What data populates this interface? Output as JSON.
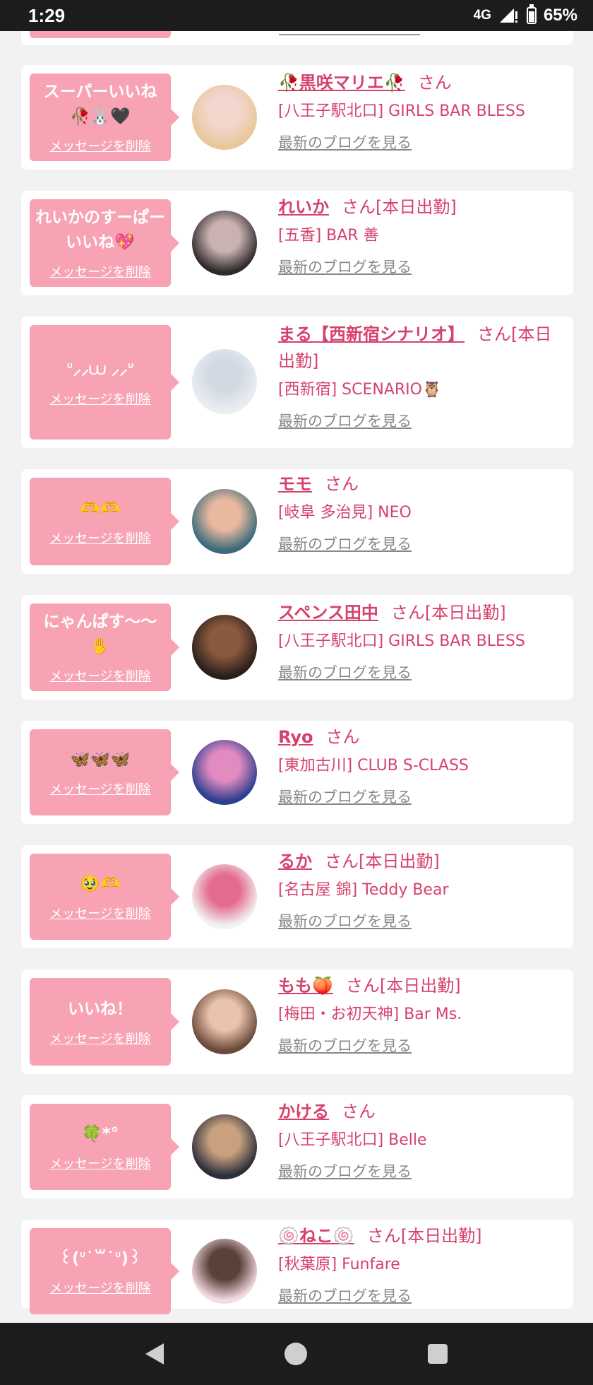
{
  "status": {
    "time": "1:29",
    "network": "4G",
    "battery": "65%"
  },
  "colors": {
    "accent": "#d6416b",
    "bubble": "#f7a3b4",
    "background": "#f2f2f2"
  },
  "common": {
    "delete_label": "メッセージを削除",
    "blog_label": "最新のブログを見る",
    "san_label": "さん"
  },
  "items": [
    {
      "message": "スーパーいいね🥀🐰🖤",
      "name": "🥀黒咲マリエ🥀",
      "suffix": "さん",
      "shop": "[八王子駅北口] GIRLS BAR BLESS",
      "avatar_colors": [
        "#e8c79a",
        "#f3d7cf"
      ]
    },
    {
      "message": "れいかのすーぱーいいね💖",
      "name": "れいか",
      "suffix": "さん[本日出勤]",
      "shop": "[五香] BAR 善",
      "avatar_colors": [
        "#2f2a2c",
        "#c9b2b0"
      ]
    },
    {
      "message": "ᐡ⸝⸝⩊ ⸝⸝ᐡ",
      "name": "まる【西新宿シナリオ】",
      "suffix": "さん[本日出勤]",
      "shop": "[西新宿] SCENARIO🦉",
      "avatar_colors": [
        "#e9eef3",
        "#d3d9e2"
      ]
    },
    {
      "message": "🫶🫶",
      "name": "モモ",
      "suffix": "さん",
      "shop": "[岐阜 多治見] NEO",
      "avatar_colors": [
        "#3b6a7a",
        "#e8b89f"
      ]
    },
    {
      "message": "にゃんぱす〜〜✋",
      "name": "スペンス田中",
      "suffix": "さん[本日出勤]",
      "shop": "[八王子駅北口] GIRLS BAR BLESS",
      "avatar_colors": [
        "#2b1e1a",
        "#8a5a3e"
      ]
    },
    {
      "message": "🦋🦋🦋",
      "name": "Ryo",
      "suffix": "さん",
      "shop": "[東加古川] CLUB S-CLASS",
      "avatar_colors": [
        "#2d3f8f",
        "#e38bc0"
      ]
    },
    {
      "message": "🥹🫶",
      "name": "るか",
      "suffix": "さん[本日出勤]",
      "shop": "[名古屋 錦] Teddy Bear",
      "avatar_colors": [
        "#f2f2f2",
        "#e46b8d"
      ]
    },
    {
      "message": "いいね！",
      "name": "もも🍑",
      "suffix": "さん[本日出勤]",
      "shop": "[梅田・お初天神] Bar Ms.",
      "avatar_colors": [
        "#6b4a3a",
        "#e9c3ad"
      ]
    },
    {
      "message": "🍀*°",
      "name": "かける",
      "suffix": "さん",
      "shop": "[八王子駅北口] Belle",
      "avatar_colors": [
        "#2b2e3b",
        "#c9a17f"
      ]
    },
    {
      "message": "꒰(ᐡ˙꒳˙ᐡ)꒱",
      "name": "🍥ねこ🍥",
      "suffix": "さん[本日出勤]",
      "shop": "[秋葉原] Funfare",
      "avatar_colors": [
        "#f4dbe3",
        "#5a4139"
      ]
    }
  ]
}
